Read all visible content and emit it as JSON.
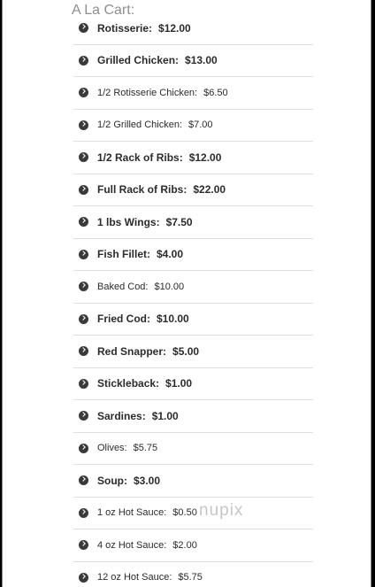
{
  "section": {
    "title": "A La Cart:"
  },
  "items": [
    {
      "name": "Rotisserie:",
      "price": "$12.00"
    },
    {
      "name": "Grilled Chicken:",
      "price": "$13.00"
    },
    {
      "name": "1/2 Rotisserie Chicken:",
      "price": "$6.50"
    },
    {
      "name": "1/2 Grilled Chicken:",
      "price": "$7.00"
    },
    {
      "name": "1/2 Rack of Ribs:",
      "price": "$12.00"
    },
    {
      "name": "Full Rack of Ribs:",
      "price": "$22.00"
    },
    {
      "name": "1 lbs Wings:",
      "price": "$7.50"
    },
    {
      "name": "Fish Fillet:",
      "price": "$4.00"
    },
    {
      "name": "Baked Cod:",
      "price": "$10.00"
    },
    {
      "name": "Fried Cod:",
      "price": "$10.00"
    },
    {
      "name": "Red Snapper:",
      "price": "$5.00"
    },
    {
      "name": "Stickleback:",
      "price": "$1.00"
    },
    {
      "name": "Sardines:",
      "price": "$1.00"
    },
    {
      "name": "Olives:",
      "price": "$5.75"
    },
    {
      "name": "Soup:",
      "price": "$3.00"
    },
    {
      "name": "1 oz Hot Sauce:",
      "price": "$0.50"
    },
    {
      "name": "4 oz Hot Sauce:",
      "price": "$2.00"
    },
    {
      "name": "12 oz Hot Sauce:",
      "price": "$5.75"
    }
  ],
  "watermark": "nupix",
  "bullet_icon": "chevron-circle-right-icon"
}
